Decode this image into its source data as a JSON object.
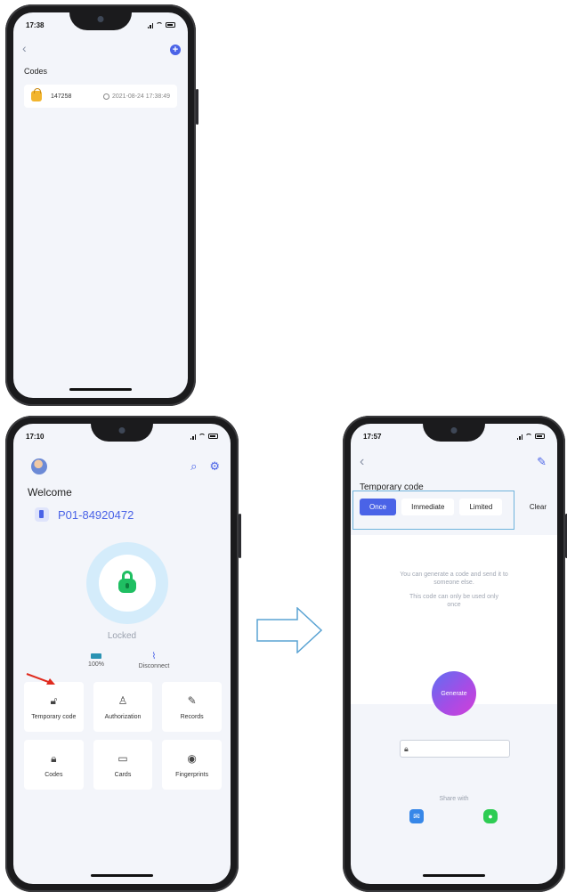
{
  "phone_codes": {
    "status_time": "17:38",
    "title": "Codes",
    "codes": [
      {
        "code": "147258",
        "timestamp": "2021-08-24 17:38:49"
      }
    ]
  },
  "phone_home": {
    "status_time": "17:10",
    "welcome": "Welcome",
    "device_id": "P01-84920472",
    "lock_status": "Locked",
    "battery": "100%",
    "connection": "Disconnect",
    "tiles": [
      {
        "label": "Temporary code",
        "icon": "padlock-icon"
      },
      {
        "label": "Authorization",
        "icon": "user-check-icon"
      },
      {
        "label": "Records",
        "icon": "edit-icon"
      },
      {
        "label": "Codes",
        "icon": "padlock-icon"
      },
      {
        "label": "Cards",
        "icon": "card-icon"
      },
      {
        "label": "Fingerprints",
        "icon": "fingerprint-icon"
      }
    ]
  },
  "phone_temp": {
    "status_time": "17:57",
    "title": "Temporary code",
    "tabs": [
      "Once",
      "Immediate",
      "Limited"
    ],
    "active_tab": "Once",
    "clear_label": "Clear",
    "description_1": "You can generate a code and send it to someone else.",
    "description_2": "This code can only be used only once",
    "generate_label": "Generate",
    "share_label": "Share with"
  },
  "colors": {
    "accent": "#4a63e7",
    "lock_green": "#1fbf62",
    "highlight_box": "#6fb3dc",
    "pointer_red": "#e02b1e"
  }
}
